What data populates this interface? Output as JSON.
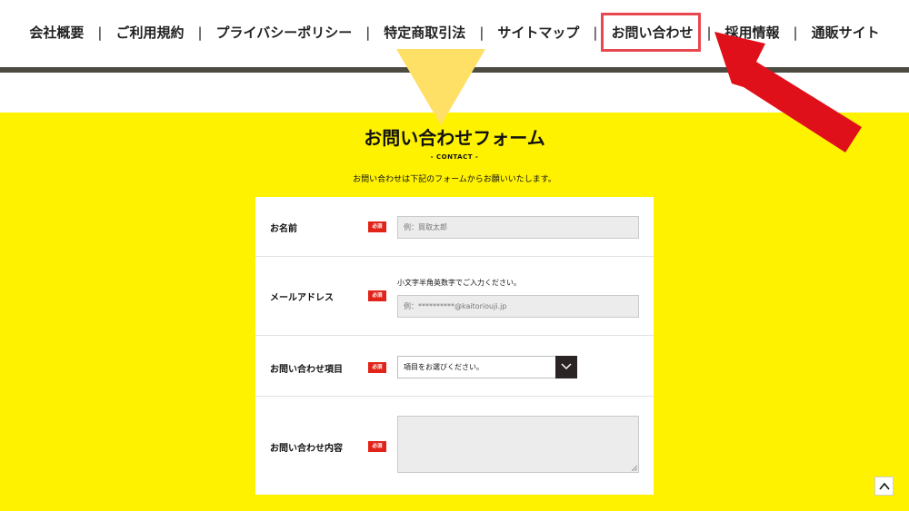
{
  "nav": {
    "items": [
      {
        "label": "会社概要"
      },
      {
        "label": "ご利用規約"
      },
      {
        "label": "プライバシーポリシー"
      },
      {
        "label": "特定商取引法"
      },
      {
        "label": "サイトマップ"
      },
      {
        "label": "お問い合わせ"
      },
      {
        "label": "採用情報"
      },
      {
        "label": "通販サイト"
      }
    ],
    "separator": "|",
    "highlighted": "お問い合わせ"
  },
  "form": {
    "title": "お問い合わせフォーム",
    "subtitle": "- CONTACT -",
    "description": "お問い合わせは下記のフォームからお願いいたします。",
    "required_badge": "必須",
    "fields": {
      "name": {
        "label": "お名前",
        "placeholder": "例：買取太郎"
      },
      "email": {
        "label": "メールアドレス",
        "hint": "小文字半角英数字でご入力ください。",
        "placeholder": "例：**********@kaitoriouji.jp"
      },
      "item": {
        "label": "お問い合わせ項目",
        "selected": "項目をお選びください。"
      },
      "content": {
        "label": "お問い合わせ内容"
      }
    }
  },
  "colors": {
    "section_bg": "#fff200",
    "triangle": "#ffe066",
    "highlight_border": "#e8484f",
    "arrow": "#e0101a",
    "badge": "#e2231a",
    "nav_bar": "#4d4a42"
  },
  "icons": {
    "select_toggle": "chevron-down-icon",
    "back_to_top": "chevron-up-icon",
    "annotation": "red-arrow-icon"
  }
}
